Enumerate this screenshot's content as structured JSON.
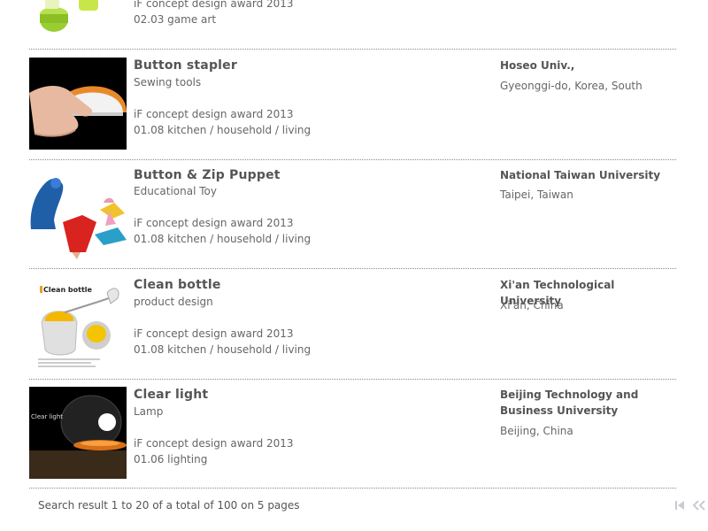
{
  "results": [
    {
      "award": "iF concept design award 2013",
      "category": "02.03 game art"
    },
    {
      "title": "Button stapler",
      "subtitle": "Sewing tools",
      "award": "iF concept design award 2013",
      "category": "01.08 kitchen / household / living",
      "school": "Hoseo Univ.,",
      "location": "Gyeonggi-do, Korea, South"
    },
    {
      "title": "Button & Zip Puppet",
      "subtitle": "Educational Toy",
      "award": "iF concept design award 2013",
      "category": "01.08 kitchen / household / living",
      "school": "National Taiwan University",
      "location": "Taipei, Taiwan"
    },
    {
      "title": "Clean bottle",
      "subtitle": "product design",
      "award": "iF concept design award 2013",
      "category": "01.08 kitchen / household / living",
      "school": "Xi'an Technological University",
      "location": "Xi'an, China",
      "thumb_caption": "Clean bottle"
    },
    {
      "title": "Clear light",
      "subtitle": "Lamp",
      "award": "iF concept design award 2013",
      "category": "01.06 lighting",
      "school": "Beijing Technology and Business University",
      "location": "Beijing, China",
      "thumb_caption": "Clear light"
    }
  ],
  "footer": {
    "summary": "Search result 1 to 20 of a total of 100 on 5 pages"
  },
  "icons": {
    "first_page": "first-page-icon",
    "previous_page": "previous-page-icon"
  },
  "colors": {
    "text": "#555555",
    "separator": "#8a8a8a",
    "pager_disabled": "#c8ccd0"
  }
}
